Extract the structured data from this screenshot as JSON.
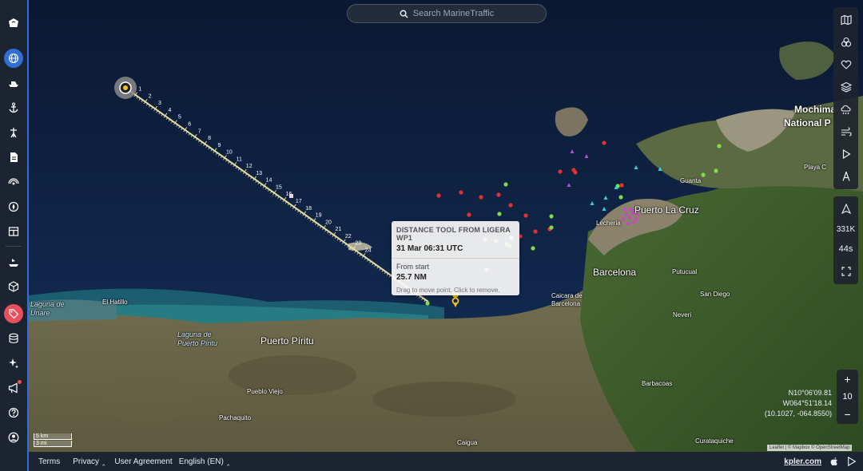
{
  "search": {
    "placeholder": "Search MarineTraffic"
  },
  "sidebar": {
    "items": [
      {
        "name": "logo-icon"
      },
      {
        "name": "globe-icon"
      },
      {
        "name": "ship-icon"
      },
      {
        "name": "anchor-icon"
      },
      {
        "name": "port-icon"
      },
      {
        "name": "document-icon"
      },
      {
        "name": "signal-icon"
      },
      {
        "name": "compass-icon"
      },
      {
        "name": "table-icon"
      },
      {
        "name": "vessel-icon"
      },
      {
        "name": "cube-icon"
      },
      {
        "name": "tag-icon"
      },
      {
        "name": "database-icon"
      },
      {
        "name": "sparkle-icon"
      },
      {
        "name": "megaphone-icon"
      },
      {
        "name": "help-icon"
      },
      {
        "name": "user-icon"
      }
    ]
  },
  "right_tools": {
    "live_ships": "331K",
    "refresh": "44s"
  },
  "zoom": {
    "plus": "+",
    "level": "10",
    "minus": "−"
  },
  "coords": {
    "lat": "N10°06'09.81",
    "lon": "W064°51'18.14",
    "decimal": "(10.1027, -064.8550)"
  },
  "scale": {
    "km": "5 km",
    "mi": "3 mi"
  },
  "attribution": "Leaflet | © Mapbox © OpenStreetMap",
  "tooltip": {
    "title": "DISTANCE TOOL FROM LIGERA WP1",
    "date": "31 Mar 06:31 UTC",
    "label": "From start",
    "distance": "25.7 NM",
    "hint": "Drag to move point. Click to remove."
  },
  "ruler": {
    "ticks": [
      "1",
      "2",
      "3",
      "4",
      "5",
      "6",
      "7",
      "8",
      "9",
      "10",
      "11",
      "12",
      "13",
      "14",
      "15",
      "16",
      "17",
      "18",
      "19",
      "20",
      "21",
      "22",
      "23",
      "24"
    ]
  },
  "map_labels": {
    "mochima": "Mochima",
    "national_park": "National P",
    "playa": "Playa C",
    "guanta": "Guanta",
    "puerto_la_cruz": "Puerto La Cruz",
    "lecheria": "Lecheria",
    "barcelona": "Barcelona",
    "putucual": "Putucual",
    "san_diego": "San Diego",
    "caicara": "Caicara de Barcelona",
    "neveri": "Neveri",
    "barbacoas": "Barbacoas",
    "curataquiche": "Curataquiche",
    "caigua": "Caigua",
    "puerto_piritu": "Puerto Píritu",
    "laguna_piritu": "Laguna de Puerto Píritu",
    "el_hatillo": "El Hatillo",
    "laguna_unare": "Laguna de Unare",
    "pueblo_viejo": "Pueblo Viejo",
    "pachaquito": "Pachaquito"
  },
  "bottombar": {
    "terms": "Terms",
    "privacy": "Privacy",
    "user_agreement": "User Agreement",
    "language": "English (EN)",
    "kpler": "kpler.com"
  },
  "colors": {
    "sea": "#0f1f3d",
    "land": "#6e6a4f",
    "vegetation": "#3e5a2e",
    "accent": "#2f6fd6",
    "ruler": "#e4dca0",
    "vessel_red": "#e53030",
    "vessel_green": "#7ddc4c",
    "vessel_magenta": "#d43cd8"
  }
}
